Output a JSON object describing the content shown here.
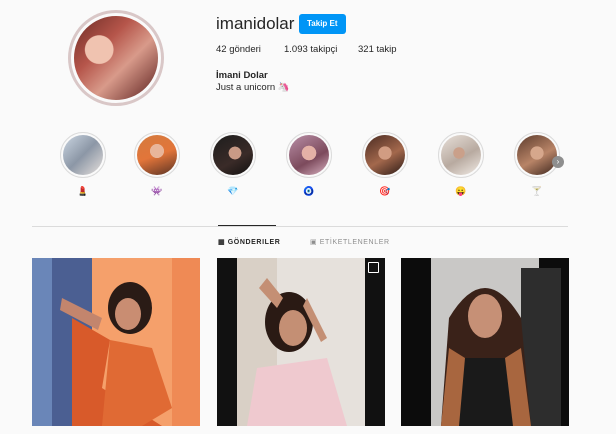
{
  "profile": {
    "username": "imanidolar",
    "follow_label": "Takip Et",
    "stats": {
      "posts": "42 gönderi",
      "followers": "1.093 takipçi",
      "following": "321 takip"
    },
    "full_name": "İmani Dolar",
    "bio": "Just a unicorn 🦄"
  },
  "highlights": [
    {
      "emoji": "💄"
    },
    {
      "emoji": "👾"
    },
    {
      "emoji": "💎"
    },
    {
      "emoji": "🧿"
    },
    {
      "emoji": "🎯"
    },
    {
      "emoji": "😛"
    },
    {
      "emoji": "🍸"
    }
  ],
  "tabs": {
    "posts": "GÖNDERILER",
    "tagged": "ETİKETLENENLER"
  },
  "colors": {
    "accent": "#0095f6"
  }
}
